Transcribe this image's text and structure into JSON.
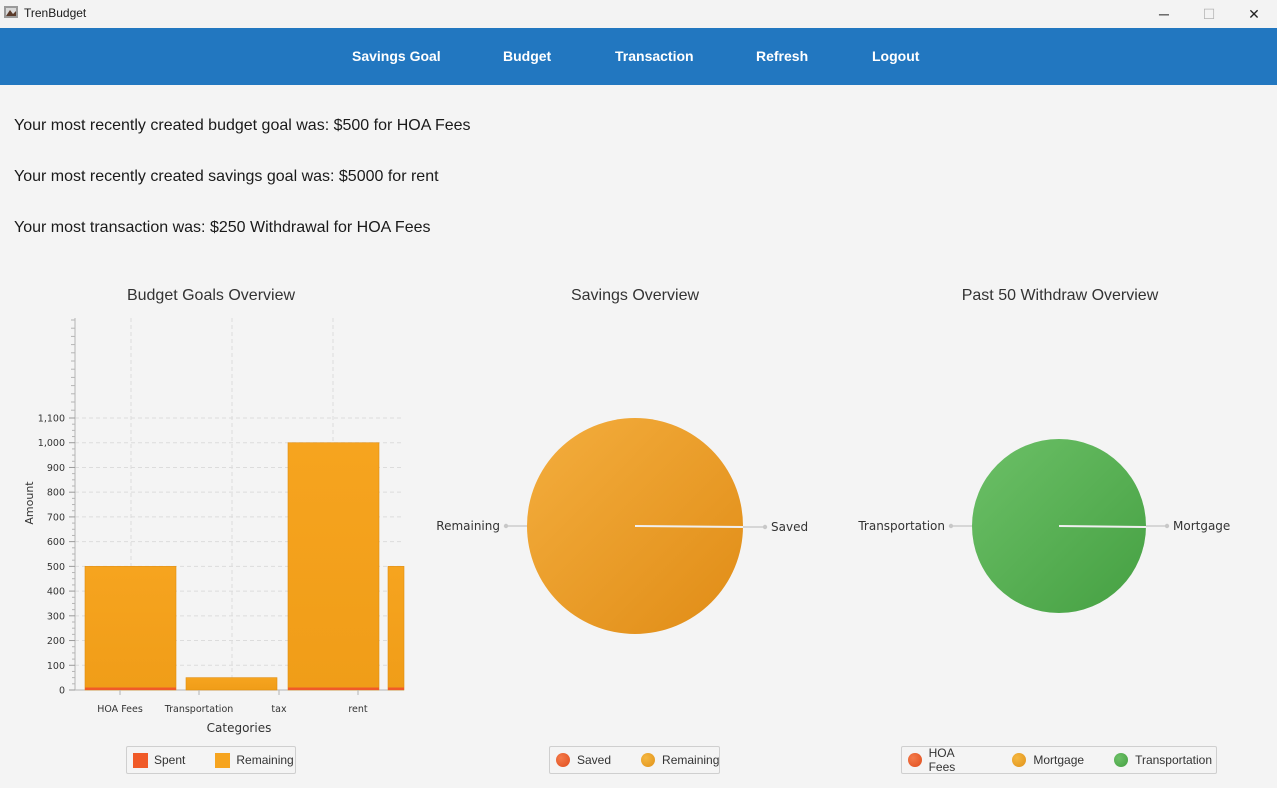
{
  "window": {
    "title": "TrenBudget",
    "minimize_glyph": "─",
    "maximize_glyph": "☐",
    "close_glyph": "✕"
  },
  "nav": {
    "items": [
      "Savings Goal",
      "Budget",
      "Transaction",
      "Refresh",
      "Logout"
    ]
  },
  "info": {
    "budget_line": "Your most recently created budget goal was: $500 for HOA Fees",
    "savings_line": "Your most recently created savings goal was: $5000 for rent",
    "transaction_line": "Your most transaction was: $250 Withdrawal for HOA Fees"
  },
  "colors": {
    "nav_bg": "#2277c0",
    "spent": "#f05a28",
    "remaining": "#f6a41f",
    "saved": "#f05a28",
    "hoa": "#f05a28",
    "mortgage": "#f0a020",
    "transportation": "#4ea84b"
  },
  "chart_data": [
    {
      "type": "bar",
      "title": "Budget Goals Overview",
      "xlabel": "Categories",
      "ylabel": "Amount",
      "categories": [
        "HOA Fees",
        "Transportation",
        "tax",
        "rent"
      ],
      "series": [
        {
          "name": "Spent",
          "values": [
            5,
            0,
            5,
            5
          ]
        },
        {
          "name": "Remaining",
          "values": [
            500,
            50,
            1000,
            500
          ]
        }
      ],
      "y_ticks": [
        "0",
        "100",
        "200",
        "300",
        "400",
        "500",
        "600",
        "700",
        "800",
        "900",
        "1,000",
        "1,100"
      ],
      "ylim": [
        0,
        1100
      ],
      "legend": [
        "Spent",
        "Remaining"
      ],
      "legend_position": "bottom"
    },
    {
      "type": "pie",
      "title": "Savings Overview",
      "slices": [
        {
          "label": "Saved",
          "value": 0
        },
        {
          "label": "Remaining",
          "value": 100
        }
      ],
      "legend": [
        "Saved",
        "Remaining"
      ],
      "legend_position": "bottom"
    },
    {
      "type": "pie",
      "title": "Past 50 Withdraw Overview",
      "slices": [
        {
          "label": "HOA Fees",
          "value": 0
        },
        {
          "label": "Mortgage",
          "value": 0
        },
        {
          "label": "Transportation",
          "value": 100
        }
      ],
      "legend": [
        "HOA Fees",
        "Mortgage",
        "Transportation"
      ],
      "legend_position": "bottom"
    }
  ]
}
